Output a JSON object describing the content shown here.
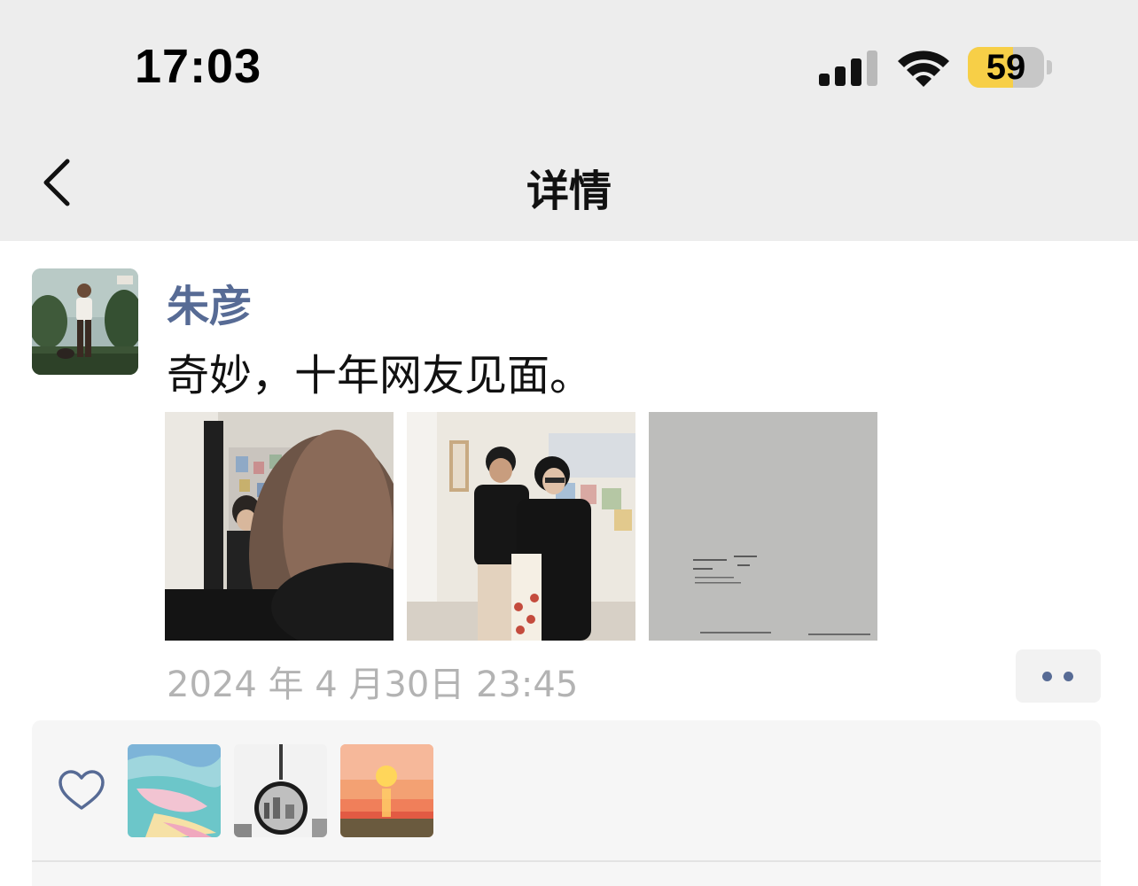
{
  "status_bar": {
    "time": "17:03",
    "battery_level": "59",
    "battery_fraction": 0.59,
    "signal_bars_active": 3,
    "signal_bars_total": 4,
    "icons": [
      "cellular-signal-icon",
      "wifi-icon",
      "battery-icon"
    ],
    "battery_fill_color": "#f7cf47"
  },
  "nav": {
    "title": "详情",
    "back_icon": "chevron-left-icon"
  },
  "post": {
    "author": "朱彦",
    "text": "奇妙，十年网友见面。",
    "timestamp": "2024 年 4 月30日 23:45",
    "name_color": "#576b95",
    "photos": [
      {
        "name": "post-photo-1",
        "subject": "blurred face in foreground, person drinking in background"
      },
      {
        "name": "post-photo-2",
        "subject": "two people standing in a bookshop"
      },
      {
        "name": "post-photo-3",
        "subject": "grey page with small printed text"
      }
    ],
    "more_icon": "ellipsis-icon"
  },
  "likes": {
    "like_icon": "heart-outline-icon",
    "likers": [
      {
        "name": "liker-avatar-1",
        "subject": "pastel beach illustration"
      },
      {
        "name": "liker-avatar-2",
        "subject": "black and white convex mirror"
      },
      {
        "name": "liker-avatar-3",
        "subject": "orange sunset over water"
      }
    ]
  }
}
